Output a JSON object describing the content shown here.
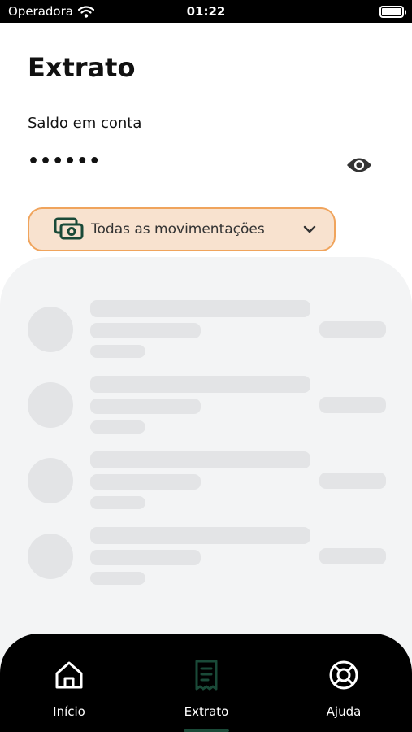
{
  "status_bar": {
    "carrier": "Operadora",
    "time": "01:22"
  },
  "header": {
    "title": "Extrato",
    "balance_label": "Saldo em conta",
    "balance_value": "••••••",
    "toggle_visibility_icon": "eye-icon"
  },
  "filter": {
    "selected_label": "Todas as movimentações",
    "icon": "cash-icon",
    "chevron_icon": "chevron-down-icon"
  },
  "transactions": {
    "state": "loading",
    "skeleton_rows": 4
  },
  "bottom_nav": {
    "items": [
      {
        "label": "Início",
        "icon": "home-icon",
        "active": false
      },
      {
        "label": "Extrato",
        "icon": "receipt-icon",
        "active": true
      },
      {
        "label": "Ajuda",
        "icon": "lifebuoy-icon",
        "active": false
      }
    ]
  },
  "colors": {
    "filter_background": "#f8e2cf",
    "filter_border": "#f0a45c",
    "brand_green": "#1a4a38",
    "skeleton": "#e3e4e6",
    "panel_background": "#f3f4f5",
    "nav_background": "#000000"
  }
}
